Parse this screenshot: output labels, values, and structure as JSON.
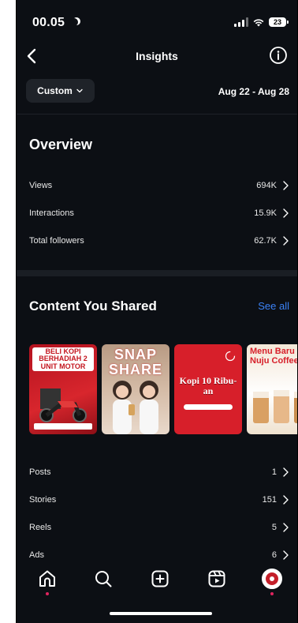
{
  "status": {
    "time": "00.05",
    "battery": "23"
  },
  "header": {
    "title": "Insights"
  },
  "filter": {
    "custom_label": "Custom",
    "date_range": "Aug 22 - Aug 28"
  },
  "overview": {
    "title": "Overview",
    "rows": [
      {
        "label": "Views",
        "value": "694K"
      },
      {
        "label": "Interactions",
        "value": "15.9K"
      },
      {
        "label": "Total followers",
        "value": "62.7K"
      }
    ]
  },
  "content_shared": {
    "title": "Content You Shared",
    "see_all": "See all",
    "thumbnails": [
      {
        "caption": "BELI KOPI BERHADIAH 2 UNIT MOTOR"
      },
      {
        "caption": "SNAP SHARE"
      },
      {
        "caption": "Kopi 10 Ribu-an"
      },
      {
        "caption": "Menu Baru di Nuju Coffee"
      }
    ],
    "rows": [
      {
        "label": "Posts",
        "value": "1"
      },
      {
        "label": "Stories",
        "value": "151"
      },
      {
        "label": "Reels",
        "value": "5"
      },
      {
        "label": "Ads",
        "value": "6"
      }
    ]
  },
  "tabbar": {
    "icons": [
      "home-icon",
      "search-icon",
      "create-icon",
      "reels-icon",
      "profile-avatar"
    ]
  },
  "colors": {
    "background": "#0c0f14",
    "accent_link": "#3b82f6",
    "notification_dot": "#e0245e"
  }
}
